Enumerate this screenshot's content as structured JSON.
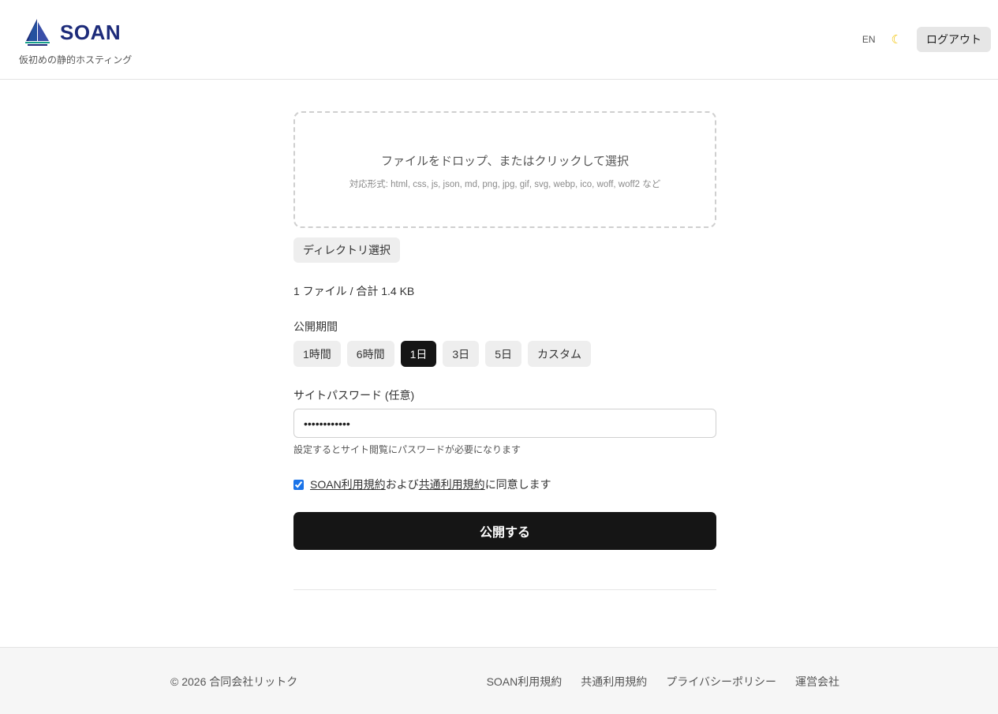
{
  "header": {
    "brand": "SOAN",
    "tagline": "仮初めの静的ホスティング",
    "lang_toggle": "EN",
    "theme_icon": "moon-icon",
    "logout_label": "ログアウト"
  },
  "upload": {
    "dropzone_title": "ファイルをドロップ、またはクリックして選択",
    "dropzone_formats": "対応形式: html, css, js, json, md, png, jpg, gif, svg, webp, ico, woff, woff2 など",
    "dir_button_label": "ディレクトリ選択",
    "summary": "1 ファイル / 合計 1.4 KB"
  },
  "period": {
    "label": "公開期間",
    "options": [
      "1時間",
      "6時間",
      "1日",
      "3日",
      "5日",
      "カスタム"
    ],
    "selected": "1日"
  },
  "password": {
    "label": "サイトパスワード (任意)",
    "value": "••••••••••••",
    "help": "設定するとサイト閲覧にパスワードが必要になります"
  },
  "agreement": {
    "checked": true,
    "link1": "SOAN利用規約",
    "mid": "および",
    "link2": "共通利用規約",
    "suffix": "に同意します"
  },
  "publish_label": "公開する",
  "footer": {
    "copyright": "© 2026 合同会社リットク",
    "links": [
      "SOAN利用規約",
      "共通利用規約",
      "プライバシーポリシー",
      "運営会社"
    ]
  },
  "colors": {
    "brand": "#1d2b7a",
    "primary_button": "#151515",
    "accent_teal": "#17a08a"
  }
}
